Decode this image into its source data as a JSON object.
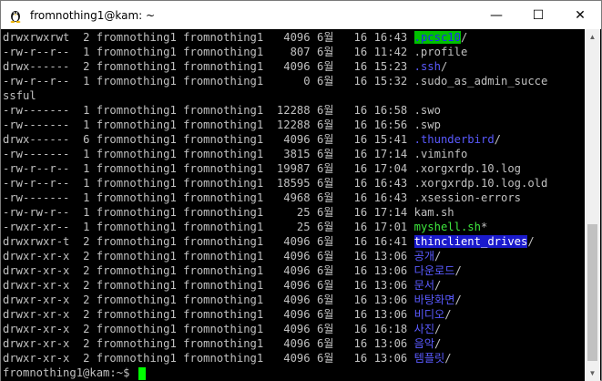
{
  "window": {
    "title": "fromnothing1@kam: ~",
    "minimize": "—",
    "maximize": "☐",
    "close": "✕"
  },
  "terminal": {
    "lines": [
      {
        "perm": "drwxrwxrwt",
        "links": "2",
        "owner": "fromnothing1",
        "group": "fromnothing1",
        "size": "4096",
        "month": "6월",
        "day": "16",
        "time": "16:43",
        "name": ".pcsc10",
        "suffix": "/",
        "style": "hl-green"
      },
      {
        "perm": "-rw-r--r--",
        "links": "1",
        "owner": "fromnothing1",
        "group": "fromnothing1",
        "size": "807",
        "month": "6월",
        "day": "16",
        "time": "11:42",
        "name": ".profile",
        "suffix": "",
        "style": ""
      },
      {
        "perm": "drwx------",
        "links": "2",
        "owner": "fromnothing1",
        "group": "fromnothing1",
        "size": "4096",
        "month": "6월",
        "day": "16",
        "time": "15:23",
        "name": ".ssh",
        "suffix": "/",
        "style": "dir"
      },
      {
        "perm": "-rw-r--r--",
        "links": "1",
        "owner": "fromnothing1",
        "group": "fromnothing1",
        "size": "0",
        "month": "6월",
        "day": "16",
        "time": "15:32",
        "name": ".sudo_as_admin_succe",
        "suffix": "",
        "style": ""
      },
      {
        "raw": "ssful"
      },
      {
        "perm": "-rw-------",
        "links": "1",
        "owner": "fromnothing1",
        "group": "fromnothing1",
        "size": "12288",
        "month": "6월",
        "day": "16",
        "time": "16:58",
        "name": ".swo",
        "suffix": "",
        "style": ""
      },
      {
        "perm": "-rw-------",
        "links": "1",
        "owner": "fromnothing1",
        "group": "fromnothing1",
        "size": "12288",
        "month": "6월",
        "day": "16",
        "time": "16:56",
        "name": ".swp",
        "suffix": "",
        "style": ""
      },
      {
        "perm": "drwx------",
        "links": "6",
        "owner": "fromnothing1",
        "group": "fromnothing1",
        "size": "4096",
        "month": "6월",
        "day": "16",
        "time": "15:41",
        "name": ".thunderbird",
        "suffix": "/",
        "style": "dir"
      },
      {
        "perm": "-rw-------",
        "links": "1",
        "owner": "fromnothing1",
        "group": "fromnothing1",
        "size": "3815",
        "month": "6월",
        "day": "16",
        "time": "17:14",
        "name": ".viminfo",
        "suffix": "",
        "style": ""
      },
      {
        "perm": "-rw-r--r--",
        "links": "1",
        "owner": "fromnothing1",
        "group": "fromnothing1",
        "size": "19987",
        "month": "6월",
        "day": "16",
        "time": "17:04",
        "name": ".xorgxrdp.10.log",
        "suffix": "",
        "style": ""
      },
      {
        "perm": "-rw-r--r--",
        "links": "1",
        "owner": "fromnothing1",
        "group": "fromnothing1",
        "size": "18595",
        "month": "6월",
        "day": "16",
        "time": "16:43",
        "name": ".xorgxrdp.10.log.old",
        "suffix": "",
        "style": ""
      },
      {
        "perm": "-rw-------",
        "links": "1",
        "owner": "fromnothing1",
        "group": "fromnothing1",
        "size": "4968",
        "month": "6월",
        "day": "16",
        "time": "16:43",
        "name": ".xsession-errors",
        "suffix": "",
        "style": ""
      },
      {
        "perm": "-rw-rw-r--",
        "links": "1",
        "owner": "fromnothing1",
        "group": "fromnothing1",
        "size": "25",
        "month": "6월",
        "day": "16",
        "time": "17:14",
        "name": "kam.sh",
        "suffix": "",
        "style": ""
      },
      {
        "perm": "-rwxr-xr--",
        "links": "1",
        "owner": "fromnothing1",
        "group": "fromnothing1",
        "size": "25",
        "month": "6월",
        "day": "16",
        "time": "17:01",
        "name": "myshell.sh",
        "suffix": "*",
        "style": "exec"
      },
      {
        "perm": "drwxrwxr-t",
        "links": "2",
        "owner": "fromnothing1",
        "group": "fromnothing1",
        "size": "4096",
        "month": "6월",
        "day": "16",
        "time": "16:41",
        "name": "thinclient_drives",
        "suffix": "/",
        "style": "hl-blue"
      },
      {
        "perm": "drwxr-xr-x",
        "links": "2",
        "owner": "fromnothing1",
        "group": "fromnothing1",
        "size": "4096",
        "month": "6월",
        "day": "16",
        "time": "13:06",
        "name": "공개",
        "suffix": "/",
        "style": "dir"
      },
      {
        "perm": "drwxr-xr-x",
        "links": "2",
        "owner": "fromnothing1",
        "group": "fromnothing1",
        "size": "4096",
        "month": "6월",
        "day": "16",
        "time": "13:06",
        "name": "다운로드",
        "suffix": "/",
        "style": "dir"
      },
      {
        "perm": "drwxr-xr-x",
        "links": "2",
        "owner": "fromnothing1",
        "group": "fromnothing1",
        "size": "4096",
        "month": "6월",
        "day": "16",
        "time": "13:06",
        "name": "문서",
        "suffix": "/",
        "style": "dir"
      },
      {
        "perm": "drwxr-xr-x",
        "links": "2",
        "owner": "fromnothing1",
        "group": "fromnothing1",
        "size": "4096",
        "month": "6월",
        "day": "16",
        "time": "13:06",
        "name": "바탕화면",
        "suffix": "/",
        "style": "dir"
      },
      {
        "perm": "drwxr-xr-x",
        "links": "2",
        "owner": "fromnothing1",
        "group": "fromnothing1",
        "size": "4096",
        "month": "6월",
        "day": "16",
        "time": "13:06",
        "name": "비디오",
        "suffix": "/",
        "style": "dir"
      },
      {
        "perm": "drwxr-xr-x",
        "links": "2",
        "owner": "fromnothing1",
        "group": "fromnothing1",
        "size": "4096",
        "month": "6월",
        "day": "16",
        "time": "16:18",
        "name": "사진",
        "suffix": "/",
        "style": "dir"
      },
      {
        "perm": "drwxr-xr-x",
        "links": "2",
        "owner": "fromnothing1",
        "group": "fromnothing1",
        "size": "4096",
        "month": "6월",
        "day": "16",
        "time": "13:06",
        "name": "음악",
        "suffix": "/",
        "style": "dir"
      },
      {
        "perm": "drwxr-xr-x",
        "links": "2",
        "owner": "fromnothing1",
        "group": "fromnothing1",
        "size": "4096",
        "month": "6월",
        "day": "16",
        "time": "13:06",
        "name": "템플릿",
        "suffix": "/",
        "style": "dir"
      }
    ],
    "prompt": "fromnothing1@kam:~$ "
  },
  "colors": {
    "background": "#000000",
    "text": "#c0c0c0",
    "directory": "#5a5aff",
    "executable": "#3ee63e",
    "cursor": "#00ff00"
  },
  "icons": {
    "app": "penguin-icon",
    "scroll_up": "arrow-up-icon",
    "scroll_down": "arrow-down-icon"
  }
}
